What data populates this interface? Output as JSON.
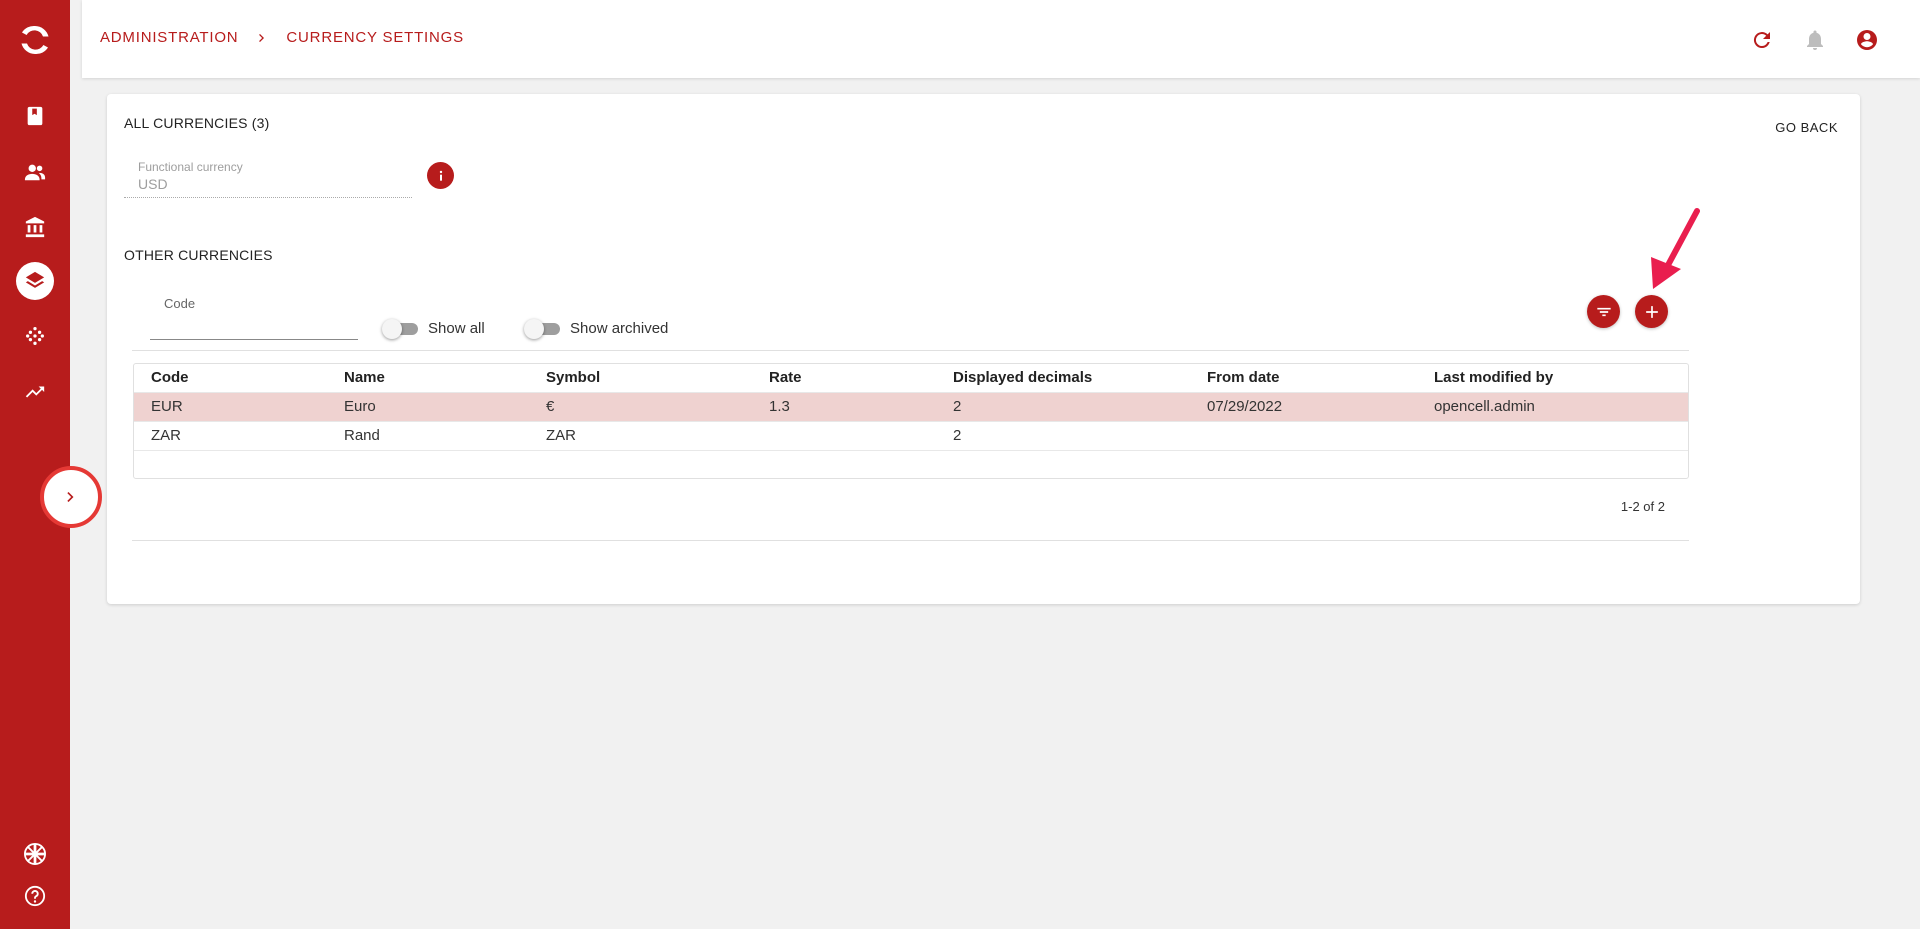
{
  "breadcrumb": {
    "items": [
      "ADMINISTRATION",
      "CURRENCY SETTINGS"
    ]
  },
  "colors": {
    "primary": "#b71c1c",
    "selected_row": "#efd2d0",
    "annotation_arrow": "#e91e4e"
  },
  "sidebar": {
    "items": [
      {
        "icon": "book-icon"
      },
      {
        "icon": "people-icon"
      },
      {
        "icon": "bank-icon"
      },
      {
        "icon": "layers-icon",
        "active": true
      },
      {
        "icon": "dots-grid-icon"
      },
      {
        "icon": "trending-up-icon"
      }
    ],
    "bottom": [
      {
        "icon": "uk-flag-icon"
      },
      {
        "icon": "help-icon"
      }
    ]
  },
  "card": {
    "title": "ALL CURRENCIES (3)",
    "go_back": "GO BACK",
    "functional_currency": {
      "label": "Functional currency",
      "value": "USD"
    },
    "other_title": "OTHER CURRENCIES",
    "filter": {
      "code_label": "Code",
      "code_value": "",
      "show_all": "Show all",
      "show_all_on": false,
      "show_archived": "Show archived",
      "show_archived_on": false
    },
    "table": {
      "columns": [
        "Code",
        "Name",
        "Symbol",
        "Rate",
        "Displayed decimals",
        "From date",
        "Last modified by"
      ],
      "rows": [
        [
          "EUR",
          "Euro",
          "€",
          "1.3",
          "2",
          "07/29/2022",
          "opencell.admin"
        ],
        [
          "ZAR",
          "Rand",
          "ZAR",
          "",
          "2",
          "",
          ""
        ]
      ],
      "selected_row": 0
    },
    "pagination": "1-2 of 2"
  }
}
